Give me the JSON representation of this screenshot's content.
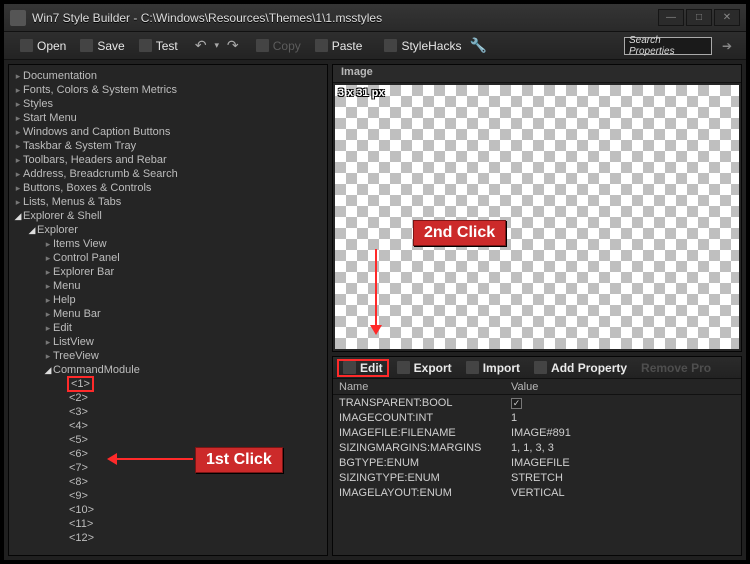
{
  "window": {
    "title": "Win7 Style Builder - C:\\Windows\\Resources\\Themes\\1\\1.msstyles"
  },
  "toolbar": {
    "open": "Open",
    "save": "Save",
    "test": "Test",
    "copy": "Copy",
    "paste": "Paste",
    "stylehacks": "StyleHacks",
    "search_placeholder": "Search Properties"
  },
  "tree": {
    "root": [
      "Documentation",
      "Fonts, Colors & System Metrics",
      "Styles",
      "Start Menu",
      "Windows and Caption Buttons",
      "Taskbar & System Tray",
      "Toolbars, Headers and Rebar",
      "Address, Breadcrumb & Search",
      "Buttons, Boxes & Controls",
      "Lists, Menus & Tabs"
    ],
    "open_node": "Explorer & Shell",
    "explorer": "Explorer",
    "explorer_children": [
      "Items View",
      "Control Panel",
      "Explorer Bar",
      "Menu",
      "Help",
      "Menu Bar",
      "Edit",
      "ListView",
      "TreeView"
    ],
    "command_module": "CommandModule",
    "cm_items": [
      "<1>",
      "<2>",
      "<3>",
      "<4>",
      "<5>",
      "<6>",
      "<7>",
      "<8>",
      "<9>",
      "<10>",
      "<11>",
      "<12>"
    ]
  },
  "preview": {
    "header": "Image",
    "dimensions": "3 x 31 px"
  },
  "props_toolbar": {
    "edit": "Edit",
    "export": "Export",
    "import": "Import",
    "add": "Add Property",
    "remove": "Remove Pro"
  },
  "props_header": {
    "name": "Name",
    "value": "Value"
  },
  "properties": [
    {
      "name": "TRANSPARENT:BOOL",
      "value": "__check__"
    },
    {
      "name": "IMAGECOUNT:INT",
      "value": "1"
    },
    {
      "name": "IMAGEFILE:FILENAME",
      "value": "IMAGE#891"
    },
    {
      "name": "SIZINGMARGINS:MARGINS",
      "value": "1, 1, 3, 3"
    },
    {
      "name": "BGTYPE:ENUM",
      "value": "IMAGEFILE"
    },
    {
      "name": "SIZINGTYPE:ENUM",
      "value": "STRETCH"
    },
    {
      "name": "IMAGELAYOUT:ENUM",
      "value": "VERTICAL"
    }
  ],
  "annotations": {
    "first_click": "1st Click",
    "second_click": "2nd Click"
  }
}
